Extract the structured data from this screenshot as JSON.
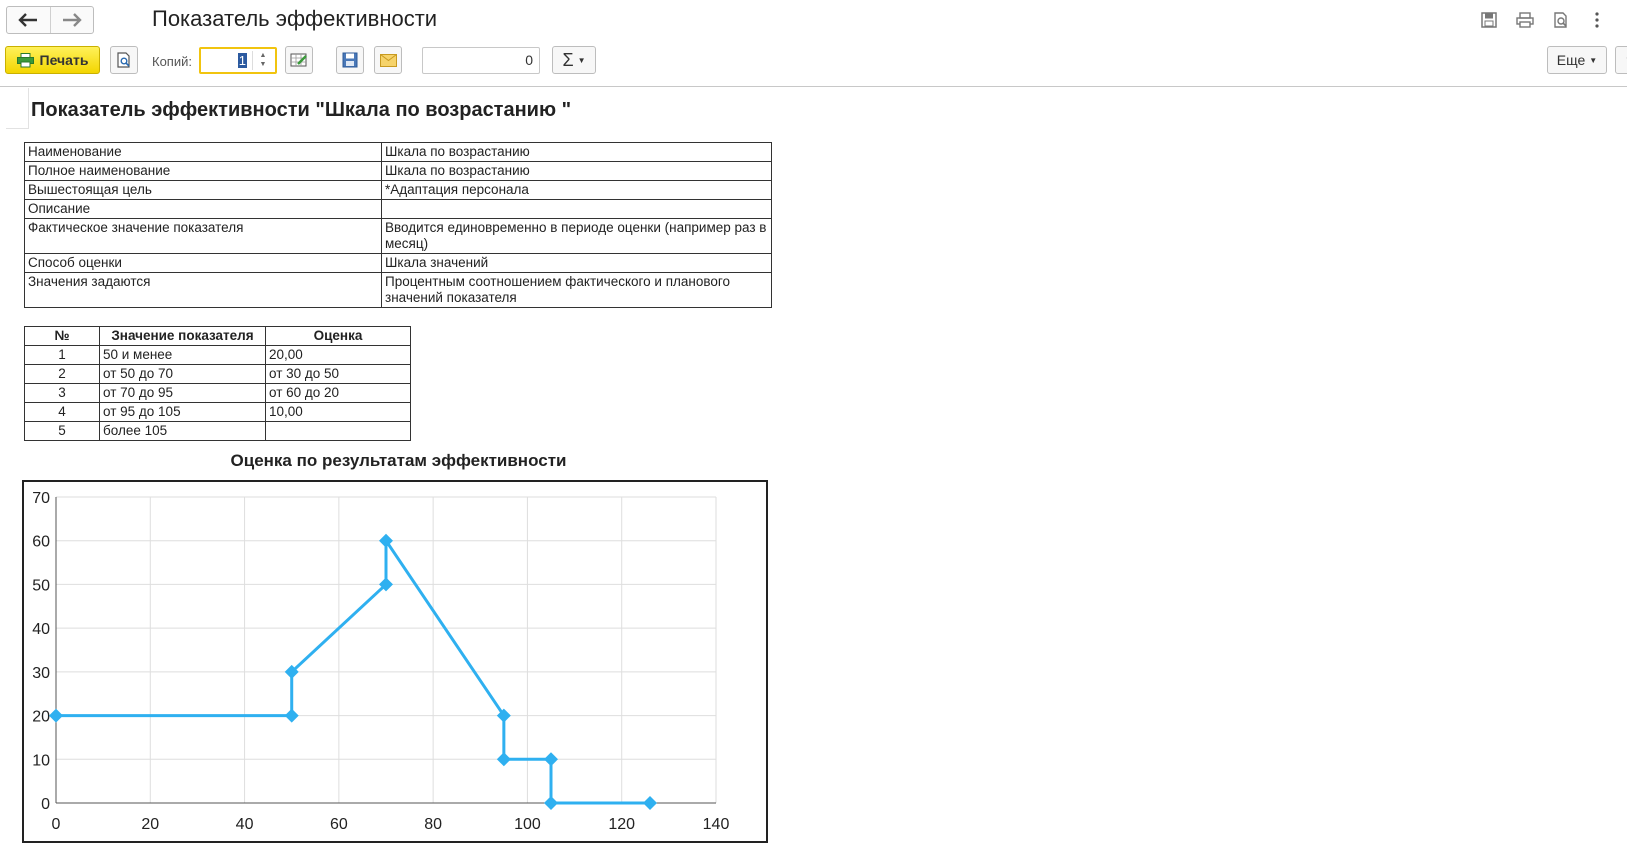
{
  "window": {
    "title": "Показатель эффективности",
    "back_icon": "arrow-left-icon",
    "forward_icon": "arrow-right-icon",
    "icons": [
      "save-icon",
      "printer-icon",
      "preview-icon",
      "more-vertical-icon"
    ]
  },
  "toolbar": {
    "print_label": "Печать",
    "copies_label": "Копий:",
    "copies_value": "1",
    "number_value": "0",
    "sum_label": "Σ",
    "more_label": "Еще",
    "help_label": "?"
  },
  "document": {
    "title": "Показатель эффективности \"Шкала по возрастанию \"",
    "properties": [
      {
        "key": "Наименование",
        "value": "Шкала по возрастанию"
      },
      {
        "key": "Полное наименование",
        "value": "Шкала по возрастанию"
      },
      {
        "key": "Вышестоящая цель",
        "value": "*Адаптация персонала"
      },
      {
        "key": "Описание",
        "value": ""
      },
      {
        "key": "Фактическое значение показателя",
        "value": "Вводится единовременно в периоде оценки (например раз в месяц)"
      },
      {
        "key": "Способ оценки",
        "value": "Шкала значений"
      },
      {
        "key": "Значения задаются",
        "value": "Процентным соотношением фактического и планового значений показателя"
      }
    ],
    "scale_table": {
      "headers": [
        "№",
        "Значение показателя",
        "Оценка"
      ],
      "rows": [
        [
          "1",
          "50 и менее",
          "20,00"
        ],
        [
          "2",
          "от 50 до 70",
          "от 30 до 50"
        ],
        [
          "3",
          "от 70 до 95",
          "от 60 до 20"
        ],
        [
          "4",
          "от 95 до 105",
          "10,00"
        ],
        [
          "5",
          "более 105",
          ""
        ]
      ]
    },
    "chart_title": "Оценка по результатам эффективности"
  },
  "chart_data": {
    "type": "line",
    "title": "Оценка по результатам эффективности",
    "xlabel": "",
    "ylabel": "",
    "xlim": [
      0,
      140
    ],
    "ylim": [
      0,
      70
    ],
    "xticks": [
      0,
      20,
      40,
      60,
      80,
      100,
      120,
      140
    ],
    "yticks": [
      0,
      10,
      20,
      30,
      40,
      50,
      60,
      70
    ],
    "grid": true,
    "color": "#2fb0f0",
    "series": [
      {
        "x": [
          0,
          50,
          50,
          70,
          70,
          95,
          95,
          105,
          105,
          126
        ],
        "y": [
          20,
          20,
          30,
          50,
          60,
          20,
          10,
          10,
          0,
          0
        ]
      }
    ]
  }
}
